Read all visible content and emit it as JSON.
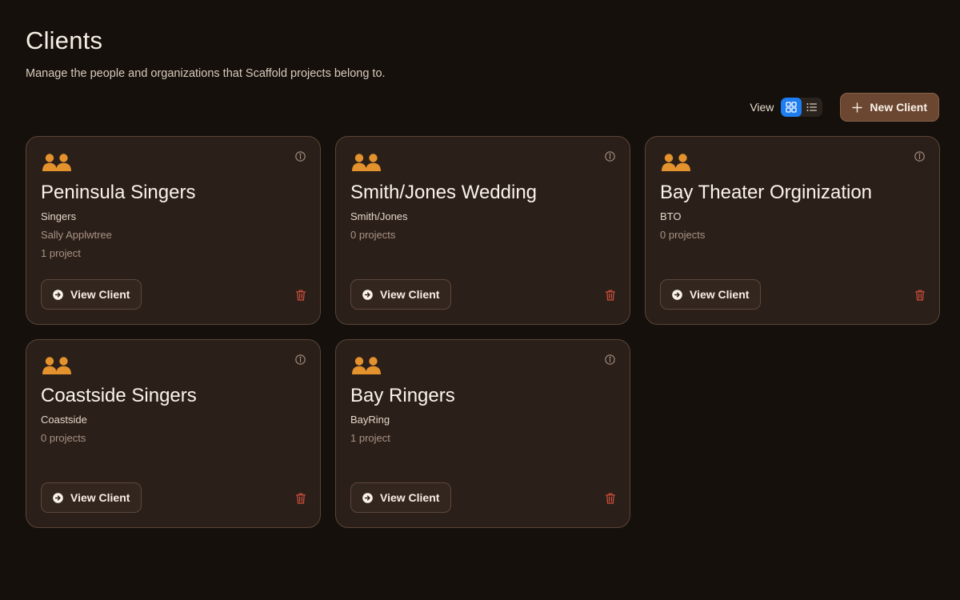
{
  "page": {
    "title": "Clients",
    "subtitle": "Manage the people and organizations that Scaffold projects belong to."
  },
  "toolbar": {
    "view_label": "View",
    "view_modes": [
      "grid",
      "list"
    ],
    "active_view": "grid",
    "new_client_label": "New Client"
  },
  "colors": {
    "accent_orange": "#e3922d",
    "delete_red": "#d2503e",
    "toggle_active": "#1f7df2"
  },
  "icons": {
    "client": "people-icon",
    "info": "info-icon",
    "view": "arrow-right-circle-icon",
    "delete": "trash-icon",
    "grid": "grid-icon",
    "list": "list-icon",
    "add": "plus-icon"
  },
  "clients": [
    {
      "name": "Peninsula Singers",
      "short": "Singers",
      "line2": "Sally Applwtree",
      "line3": "1 project",
      "button": "View Client"
    },
    {
      "name": "Smith/Jones Wedding",
      "short": "Smith/Jones",
      "line2": "0 projects",
      "line3": "",
      "button": "View Client"
    },
    {
      "name": "Bay Theater Orginization",
      "short": "BTO",
      "line2": "0 projects",
      "line3": "",
      "button": "View Client"
    },
    {
      "name": "Coastside Singers",
      "short": "Coastside",
      "line2": "0 projects",
      "line3": "",
      "button": "View Client"
    },
    {
      "name": "Bay Ringers",
      "short": "BayRing",
      "line2": "1 project",
      "line3": "",
      "button": "View Client"
    }
  ]
}
